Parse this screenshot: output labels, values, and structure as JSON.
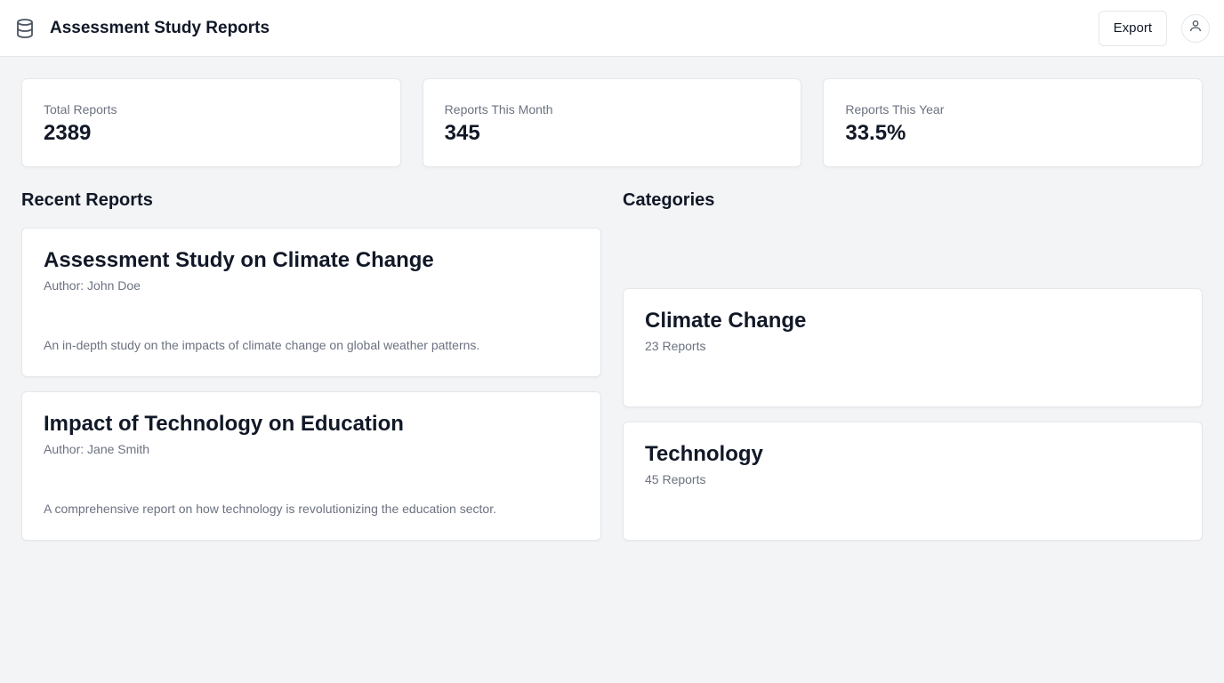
{
  "header": {
    "title": "Assessment Study Reports",
    "logo_icon": "database-icon",
    "export_label": "Export",
    "avatar_icon": "user-icon"
  },
  "stats": [
    {
      "label": "Total Reports",
      "value": "2389"
    },
    {
      "label": "Reports This Month",
      "value": "345"
    },
    {
      "label": "Reports This Year",
      "value": "33.5%"
    }
  ],
  "recent": {
    "title": "Recent Reports",
    "items": [
      {
        "title": "Assessment Study on Climate Change",
        "author": "Author: John Doe",
        "description": "An in-depth study on the impacts of climate change on global weather patterns."
      },
      {
        "title": "Impact of Technology on Education",
        "author": "Author: Jane Smith",
        "description": "A comprehensive report on how technology is revolutionizing the education sector."
      }
    ]
  },
  "categories": {
    "title": "Categories",
    "items": [
      {
        "name": "Climate Change",
        "count": "23 Reports"
      },
      {
        "name": "Technology",
        "count": "45 Reports"
      }
    ]
  },
  "colors": {
    "background": "#f3f4f6",
    "card": "#ffffff",
    "border": "#e5e7eb",
    "text": "#111827",
    "muted": "#6b7280"
  }
}
